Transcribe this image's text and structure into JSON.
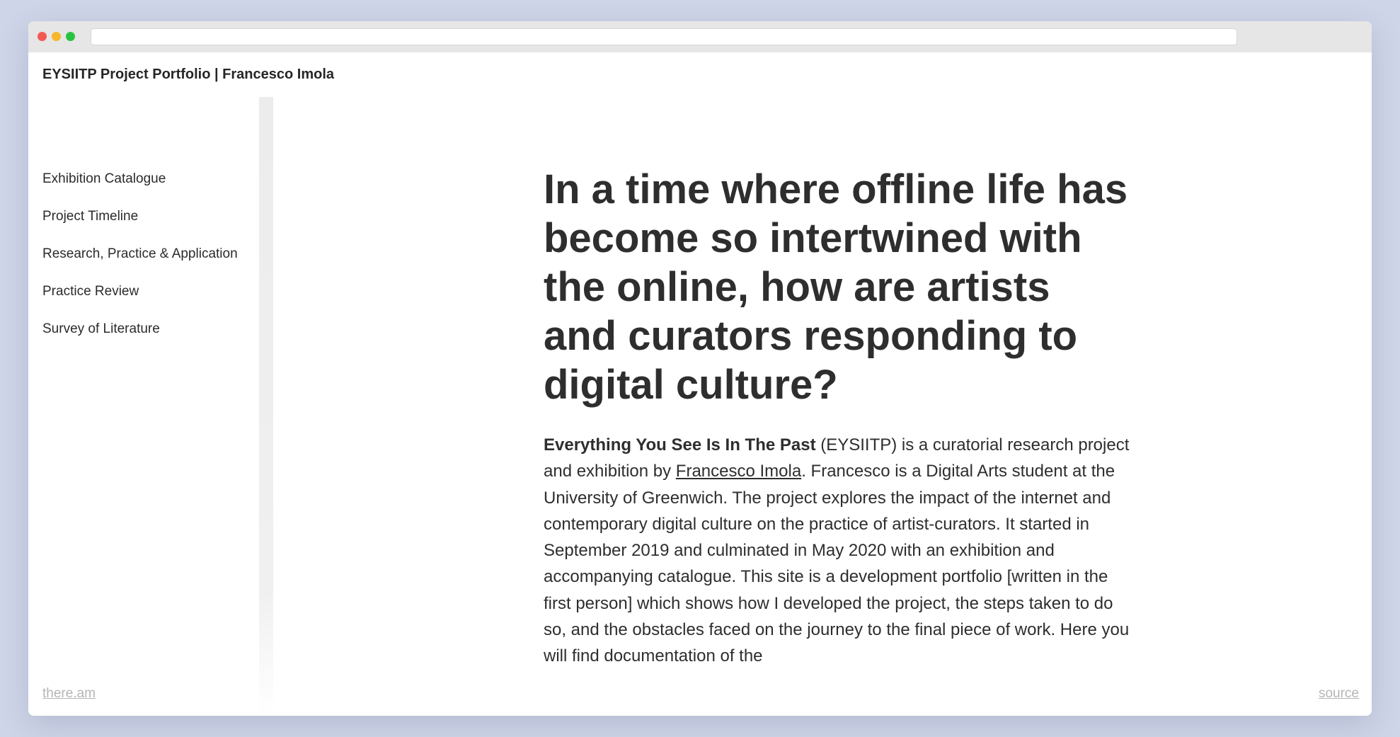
{
  "browser": {
    "url": ""
  },
  "site": {
    "title": "EYSIITP Project Portfolio | Francesco Imola"
  },
  "sidebar": {
    "items": [
      {
        "label": "Exhibition Catalogue"
      },
      {
        "label": "Project Timeline"
      },
      {
        "label": "Research, Practice & Application"
      },
      {
        "label": "Practice Review"
      },
      {
        "label": "Survey of Literature"
      }
    ]
  },
  "main": {
    "headline": "In a time where offline life has become so intertwined with the online, how are artists and curators responding to digital culture?",
    "intro": {
      "project_name": "Everything You See Is In The Past",
      "text_part1": " (EYSIITP) is a curatorial research project and exhibition by ",
      "author_link": "Francesco Imola",
      "text_part2": ". Francesco is a Digital Arts student at the University of Greenwich. The project explores the impact of the internet and contemporary digital culture on the practice of artist-curators. It started in September 2019 and culminated in May 2020 with an exhibition and accompanying catalogue. This site is a development portfolio [written in the first person] which shows how I developed the project, the steps taken to do so, and the obstacles faced on the journey to the final piece of work. Here you will find documentation of the"
    }
  },
  "footer": {
    "left_link": "there.am",
    "right_link": "source"
  },
  "colors": {
    "background": "#cfd5e8",
    "text": "#2e2e2e",
    "muted_link": "#b5b5b5",
    "close": "#f25a55",
    "minimize": "#f6b72b",
    "maximize": "#29c43f"
  }
}
